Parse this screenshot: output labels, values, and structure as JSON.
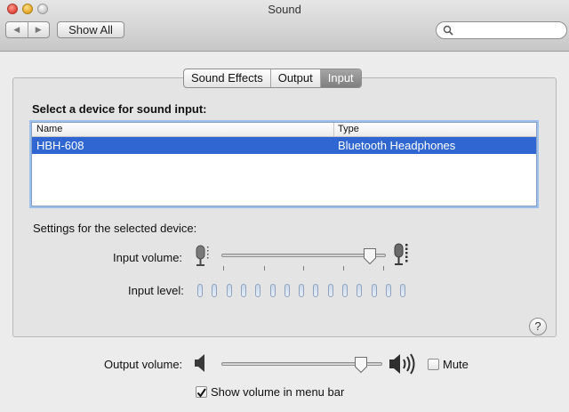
{
  "window": {
    "title": "Sound"
  },
  "toolbar": {
    "back_glyph": "◀",
    "forward_glyph": "▶",
    "show_all_label": "Show All",
    "search_value": "",
    "search_placeholder": ""
  },
  "tabs": [
    {
      "label": "Sound Effects",
      "active": false
    },
    {
      "label": "Output",
      "active": false
    },
    {
      "label": "Input",
      "active": true
    }
  ],
  "input_pane": {
    "select_heading": "Select a device for sound input:",
    "table": {
      "columns": [
        "Name",
        "Type"
      ],
      "rows": [
        {
          "name": "HBH-608",
          "type": "Bluetooth Headphones",
          "selected": true
        }
      ]
    },
    "settings_heading": "Settings for the selected device:",
    "input_volume_label": "Input volume:",
    "input_volume_fraction": 0.94,
    "input_level_label": "Input level:",
    "input_level_segments": 15,
    "input_level_lit": 0,
    "help_glyph": "?"
  },
  "footer": {
    "output_volume_label": "Output volume:",
    "output_volume_fraction": 0.9,
    "mute_label": "Mute",
    "mute_checked": false,
    "show_volume_label": "Show volume in menu bar",
    "show_volume_checked": true
  },
  "colors": {
    "selection": "#2f66d1",
    "active_tab": "#8e8e8e",
    "focus_ring": "#9bc0ec",
    "level_segment": "#c9d7ea"
  },
  "icons": {
    "close": "close-icon",
    "minimize": "minimize-icon",
    "zoom": "zoom-icon",
    "search": "search-icon",
    "mic_low": "microphone-low-icon",
    "mic_high": "microphone-high-icon",
    "speaker_low": "speaker-low-icon",
    "speaker_high": "speaker-high-icon",
    "checkmark": "checkmark-icon"
  }
}
